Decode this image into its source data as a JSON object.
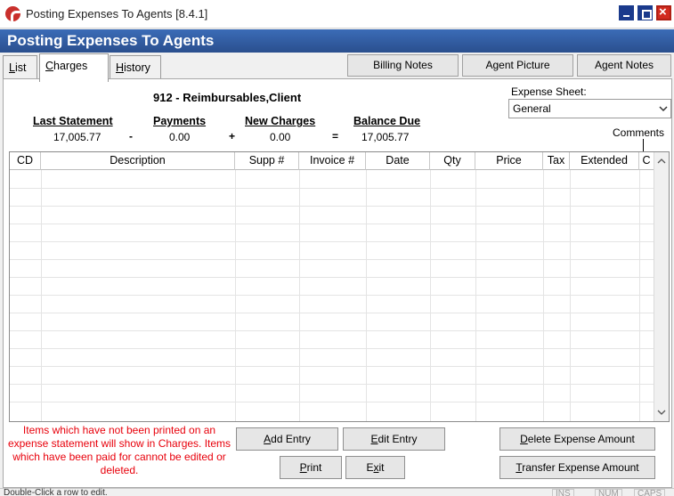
{
  "window": {
    "title": "Posting Expenses To Agents [8.4.1]",
    "header": "Posting Expenses To Agents"
  },
  "tabs": [
    {
      "label": "List",
      "accel": "L"
    },
    {
      "label": "Charges",
      "accel": "C"
    },
    {
      "label": "History",
      "accel": "H"
    }
  ],
  "active_tab": "Charges",
  "top_buttons": {
    "billing_notes": "Billing Notes",
    "agent_picture": "Agent Picture",
    "agent_notes": "Agent Notes"
  },
  "client": {
    "name": "912 - Reimbursables,Client"
  },
  "summary": {
    "last_statement_label": "Last Statement",
    "last_statement_value": "17,005.77",
    "op_minus": "-",
    "payments_label": "Payments",
    "payments_value": "0.00",
    "op_plus": "+",
    "new_charges_label": "New Charges",
    "new_charges_value": "0.00",
    "op_equals": "=",
    "balance_due_label": "Balance Due",
    "balance_due_value": "17,005.77"
  },
  "expense_sheet": {
    "label": "Expense Sheet:",
    "selected": "General"
  },
  "comments_label": "Comments",
  "table": {
    "columns": [
      "CD",
      "Description",
      "Supp #",
      "Invoice #",
      "Date",
      "Qty",
      "Price",
      "Tax",
      "Extended",
      "C"
    ],
    "rows": []
  },
  "note": "Items which have not been printed on an expense statement will show in Charges. Items which have been paid for cannot be edited or deleted.",
  "buttons": {
    "add_entry": "Add Entry",
    "edit_entry": "Edit Entry",
    "print": "Print",
    "exit": "Exit",
    "delete_expense_amount": "Delete Expense Amount",
    "transfer_expense_amount": "Transfer Expense Amount"
  },
  "status": {
    "text": "Double-Click a row to edit.",
    "indicators": [
      "INS",
      "NUM",
      "CAPS"
    ]
  },
  "colors": {
    "header_blue": "#2f5ca3",
    "note_red": "#e8000b",
    "close_red": "#d12a1e"
  }
}
